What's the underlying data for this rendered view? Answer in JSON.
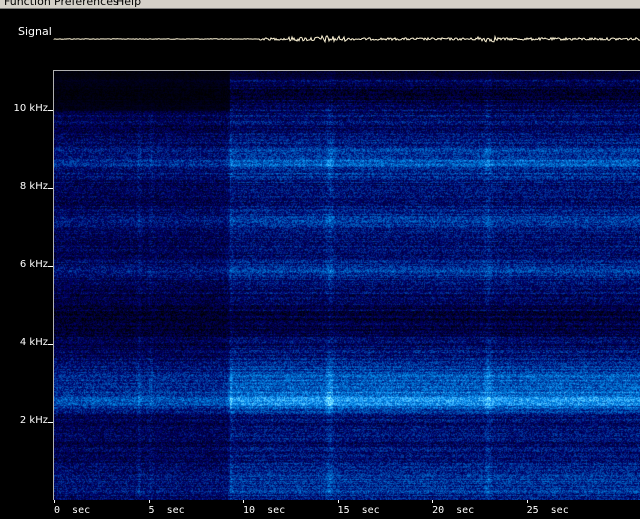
{
  "menubar": {
    "items": [
      "Function",
      "Preferences",
      "Help"
    ]
  },
  "signal": {
    "label": "Signal",
    "trace_color": "#fff6d8"
  },
  "chart_data": {
    "type": "heatmap",
    "colormap": "black-to-blue-to-cyan",
    "y_axis": {
      "unit": "kHz",
      "range": [
        0,
        11
      ],
      "ticks": [
        {
          "value": 10,
          "label": "10 kHz"
        },
        {
          "value": 8,
          "label": "8 kHz"
        },
        {
          "value": 6,
          "label": "6 kHz"
        },
        {
          "value": 4,
          "label": "4 kHz"
        },
        {
          "value": 2,
          "label": "2 kHz"
        }
      ]
    },
    "x_axis": {
      "unit": "sec",
      "range": [
        0,
        31
      ],
      "ticks": [
        {
          "value": 0,
          "label": "0  sec"
        },
        {
          "value": 5,
          "label": "5  sec"
        },
        {
          "value": 10,
          "label": "10  sec"
        },
        {
          "value": 15,
          "label": "15  sec"
        },
        {
          "value": 20,
          "label": "20  sec"
        },
        {
          "value": 25,
          "label": "25  sec"
        }
      ]
    }
  }
}
